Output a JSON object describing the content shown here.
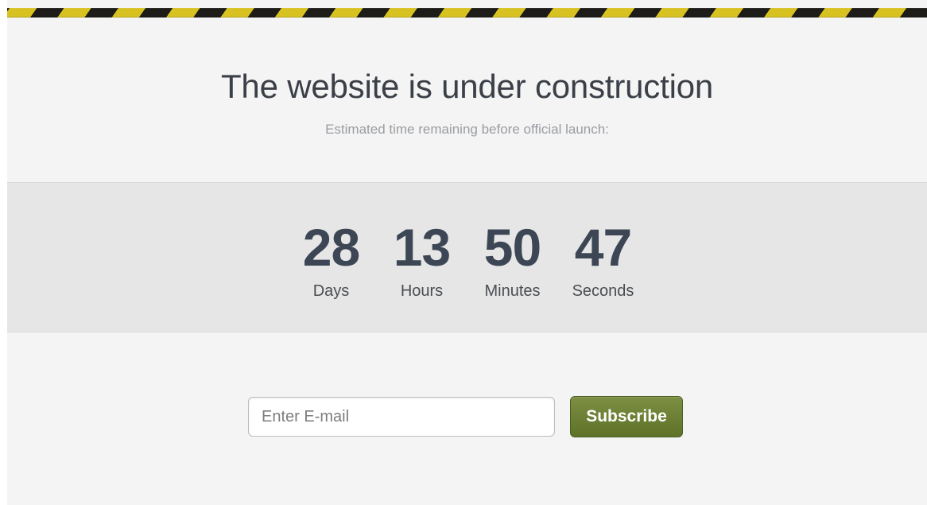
{
  "hero": {
    "title": "The website is under construction",
    "subtitle": "Estimated time remaining before official launch:"
  },
  "countdown": {
    "units": [
      {
        "value": "28",
        "label": "Days"
      },
      {
        "value": "13",
        "label": "Hours"
      },
      {
        "value": "50",
        "label": "Minutes"
      },
      {
        "value": "47",
        "label": "Seconds"
      }
    ]
  },
  "subscribe": {
    "email_placeholder": "Enter E-mail",
    "button_label": "Subscribe"
  },
  "colors": {
    "stripe_dark": "#1d1c18",
    "stripe_yellow": "#d7c222",
    "button_green": "#6b7f35",
    "countdown_background": "#e6e6e6"
  }
}
